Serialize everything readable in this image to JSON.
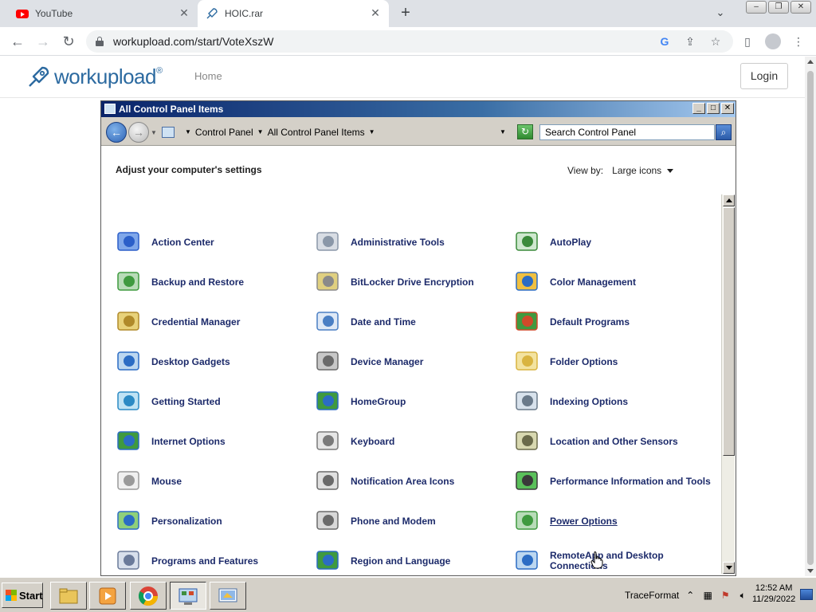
{
  "browser": {
    "tabs": [
      {
        "title": "YouTube",
        "icon": "youtube-icon",
        "active": false
      },
      {
        "title": "HOIC.rar",
        "icon": "workupload-rocket-icon",
        "active": true
      }
    ],
    "url": "workupload.com/start/VoteXszW"
  },
  "site": {
    "logo_text": "workupload",
    "logo_mark": "®",
    "nav_home": "Home",
    "login_label": "Login"
  },
  "window": {
    "title": "All Control Panel Items",
    "breadcrumb": [
      "Control Panel",
      "All Control Panel Items"
    ],
    "search_placeholder": "Search Control Panel",
    "heading": "Adjust your computer's settings",
    "viewby_label": "View by:",
    "viewby_value": "Large icons",
    "items": [
      {
        "label": "Action Center",
        "icon": "flag-icon"
      },
      {
        "label": "Administrative Tools",
        "icon": "admin-tools-icon"
      },
      {
        "label": "AutoPlay",
        "icon": "autoplay-icon"
      },
      {
        "label": "Backup and Restore",
        "icon": "backup-icon"
      },
      {
        "label": "BitLocker Drive Encryption",
        "icon": "bitlocker-icon"
      },
      {
        "label": "Color Management",
        "icon": "color-management-icon"
      },
      {
        "label": "Credential Manager",
        "icon": "credential-vault-icon"
      },
      {
        "label": "Date and Time",
        "icon": "calendar-clock-icon"
      },
      {
        "label": "Default Programs",
        "icon": "default-programs-icon"
      },
      {
        "label": "Desktop Gadgets",
        "icon": "gadgets-icon"
      },
      {
        "label": "Device Manager",
        "icon": "device-manager-icon"
      },
      {
        "label": "Folder Options",
        "icon": "folder-options-icon"
      },
      {
        "label": "Getting Started",
        "icon": "getting-started-icon"
      },
      {
        "label": "HomeGroup",
        "icon": "homegroup-icon"
      },
      {
        "label": "Indexing Options",
        "icon": "indexing-icon"
      },
      {
        "label": "Internet Options",
        "icon": "internet-globe-icon"
      },
      {
        "label": "Keyboard",
        "icon": "keyboard-icon"
      },
      {
        "label": "Location and Other Sensors",
        "icon": "sensors-icon"
      },
      {
        "label": "Mouse",
        "icon": "mouse-icon"
      },
      {
        "label": "Notification Area Icons",
        "icon": "notification-area-icon"
      },
      {
        "label": "Performance Information and Tools",
        "icon": "performance-icon"
      },
      {
        "label": "Personalization",
        "icon": "personalization-icon"
      },
      {
        "label": "Phone and Modem",
        "icon": "phone-modem-icon"
      },
      {
        "label": "Power Options",
        "icon": "battery-plug-icon"
      },
      {
        "label": "Programs and Features",
        "icon": "programs-features-icon"
      },
      {
        "label": "Region and Language",
        "icon": "region-globe-icon"
      },
      {
        "label": "RemoteApp and Desktop Connections",
        "icon": "remoteapp-icon"
      }
    ]
  },
  "taskbar": {
    "start_label": "Start",
    "tray_label": "TraceFormat",
    "time": "12:52 AM",
    "date": "11/29/2022"
  },
  "colors": {
    "link_text": "#1c2a6a",
    "title_gradient_start": "#0a246a",
    "classic_face": "#d4d0c8"
  }
}
